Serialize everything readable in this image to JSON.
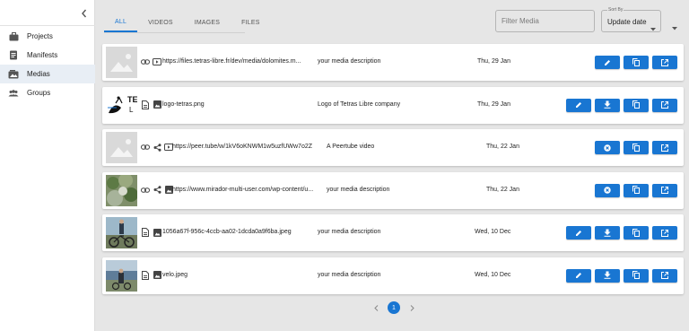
{
  "sidebar": {
    "items": [
      {
        "label": "Projects",
        "icon": "briefcase-icon"
      },
      {
        "label": "Manifests",
        "icon": "document-icon"
      },
      {
        "label": "Medias",
        "icon": "photo-library-icon",
        "active": true
      },
      {
        "label": "Groups",
        "icon": "group-icon"
      }
    ]
  },
  "tabs": [
    {
      "label": "ALL",
      "active": true
    },
    {
      "label": "VIDEOS"
    },
    {
      "label": "IMAGES"
    },
    {
      "label": "FILES"
    }
  ],
  "filter": {
    "placeholder": "Filter Media"
  },
  "sort": {
    "label": "Sort By",
    "value": "Update date"
  },
  "rows": [
    {
      "title": "https://files.tetras-libre.fr/dev/media/dolomites.m...",
      "description": "your media description",
      "date": "Thu, 29 Jan",
      "source": "link",
      "kind": "video",
      "thumbnail": "placeholder",
      "actions": [
        "edit",
        "copy",
        "open"
      ]
    },
    {
      "title": "logo-tetras.png",
      "description": "Logo of Tetras Libre company",
      "date": "Thu, 29 Jan",
      "source": "file",
      "kind": "image",
      "thumbnail": "logo",
      "actions": [
        "edit",
        "download",
        "copy",
        "open"
      ]
    },
    {
      "title": "https://peer.tube/w/1kV6oKNWM1w5uzfUWw7o2Z",
      "description": "A Peertube video",
      "date": "Thu, 22 Jan",
      "source": "link",
      "kind": "video",
      "shared": true,
      "thumbnail": "placeholder",
      "actions": [
        "remove",
        "copy",
        "open"
      ]
    },
    {
      "title": "https://www.mirador-multi-user.com/wp-content/u...",
      "description": "your media description",
      "date": "Thu, 22 Jan",
      "source": "link",
      "kind": "image",
      "shared": true,
      "thumbnail": "photo-nature",
      "actions": [
        "remove",
        "copy",
        "open"
      ]
    },
    {
      "title": "1056a67f-956c-4ccb-aa02-1dcda0a9f6ba.jpeg",
      "description": "your media description",
      "date": "Wed, 10 Dec",
      "source": "file",
      "kind": "image",
      "thumbnail": "photo-bike",
      "actions": [
        "edit",
        "download",
        "copy",
        "open"
      ]
    },
    {
      "title": "velo.jpeg",
      "description": "your media description",
      "date": "Wed, 10 Dec",
      "source": "file",
      "kind": "image",
      "thumbnail": "photo-lake",
      "actions": [
        "edit",
        "download",
        "copy",
        "open"
      ]
    }
  ],
  "pagination": {
    "current": "1"
  },
  "colors": {
    "accent": "#1976d2",
    "background": "#e6e6e6",
    "active_nav": "#e8eef5"
  }
}
